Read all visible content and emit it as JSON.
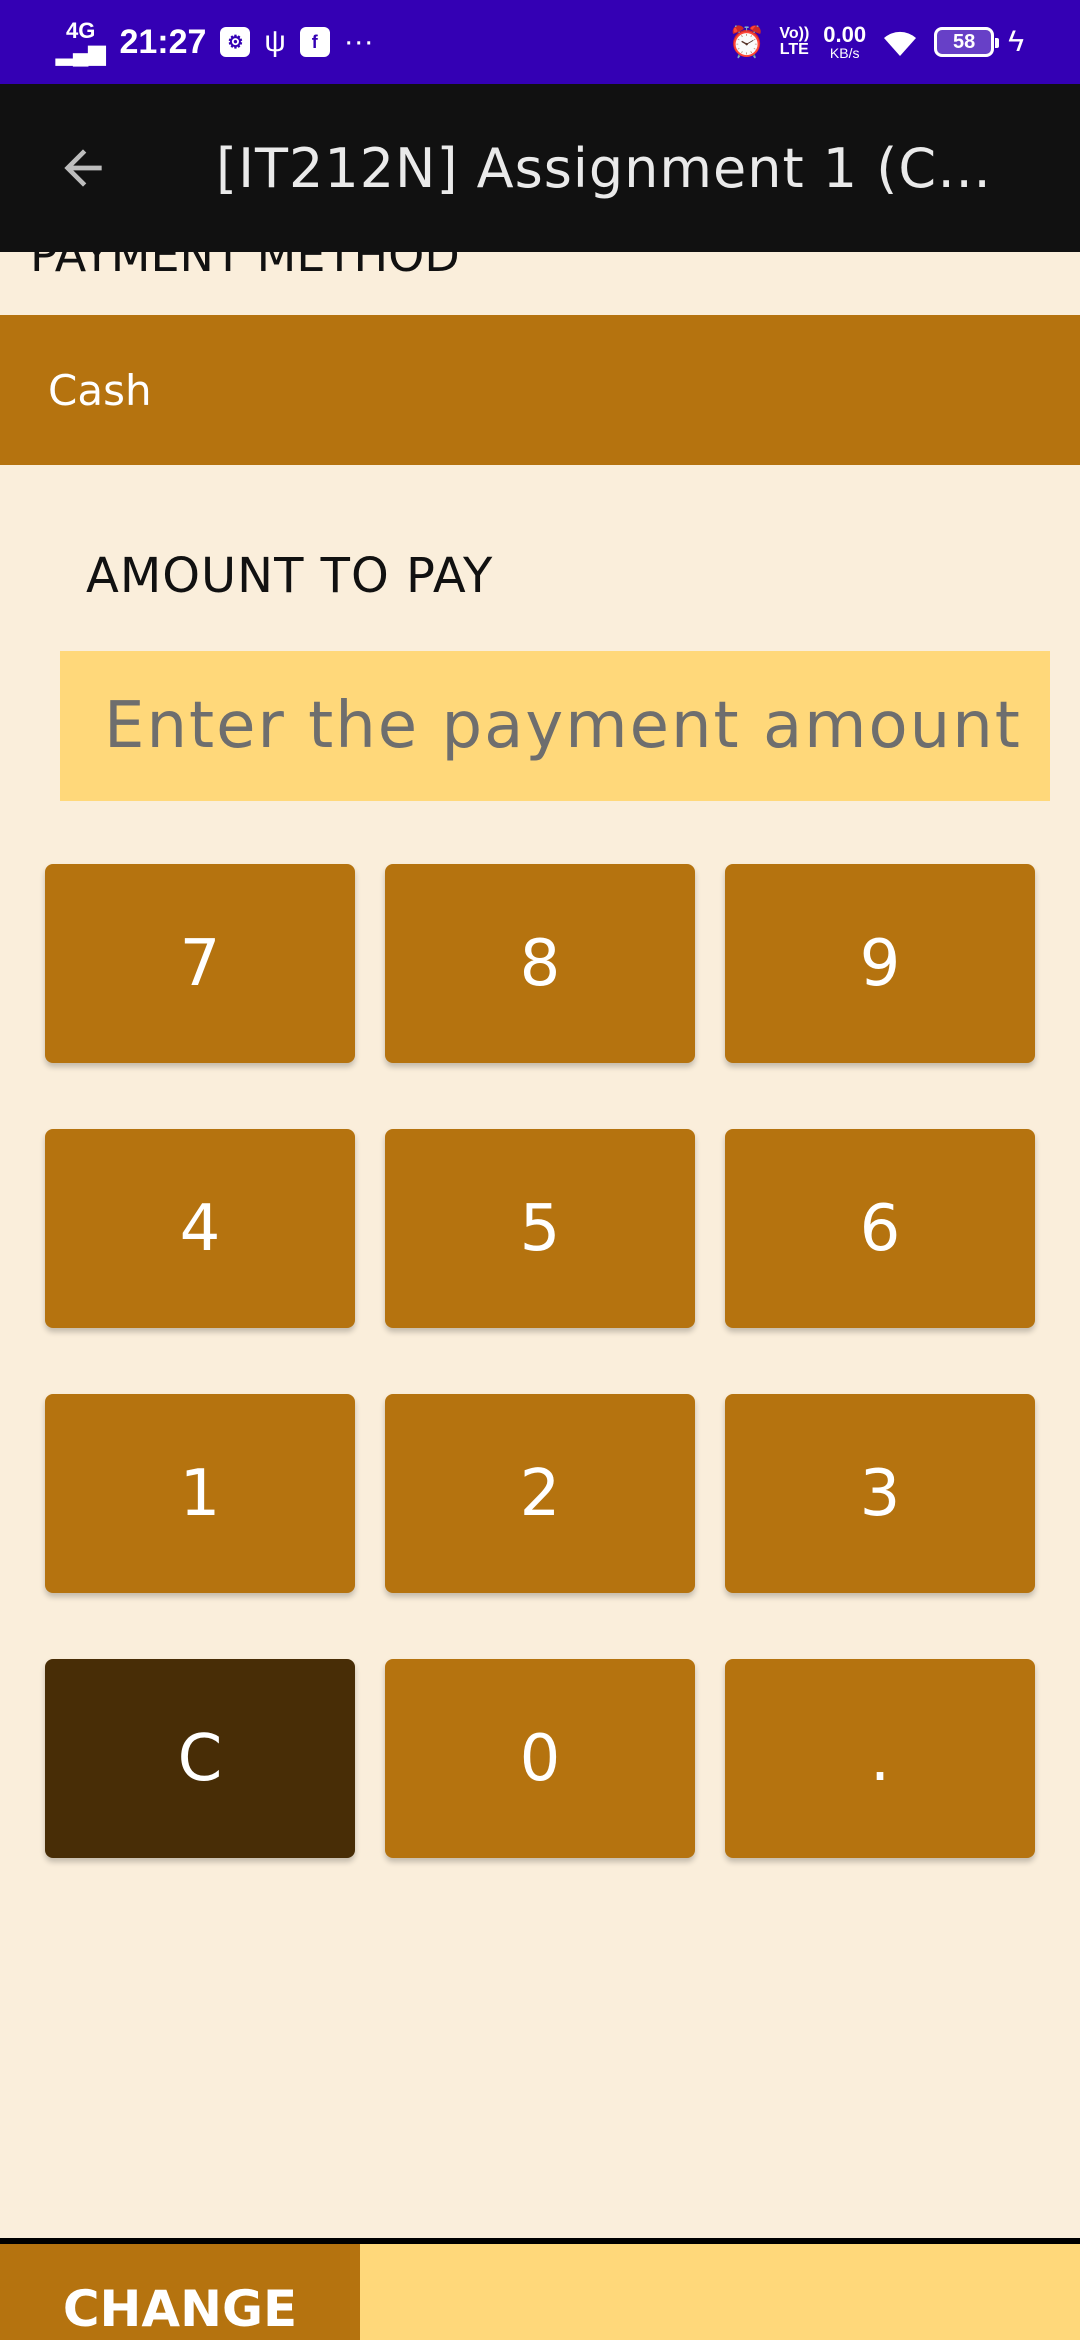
{
  "status_bar": {
    "network": "4G",
    "time": "21:27",
    "speed_value": "0.00",
    "speed_unit": "KB/s",
    "volte": "VoLTE",
    "battery": "58"
  },
  "toolbar": {
    "title": "[IT212N] Assignment 1 (Ch..."
  },
  "payment": {
    "section_title": "PAYMENT METHOD",
    "selected_method": "Cash"
  },
  "amount": {
    "label": "AMOUNT TO PAY",
    "placeholder": "Enter the payment amount",
    "value": ""
  },
  "keypad": {
    "keys": [
      "7",
      "8",
      "9",
      "4",
      "5",
      "6",
      "1",
      "2",
      "3",
      "C",
      "0",
      "."
    ]
  },
  "bottom": {
    "change_label": "CHANGE",
    "change_value": ""
  },
  "colors": {
    "status_bar": "#3400b4",
    "toolbar": "#111111",
    "accent": "#b5730f",
    "clear_key": "#482d06",
    "input_bg": "#ffd87a",
    "background": "#faeedb"
  }
}
